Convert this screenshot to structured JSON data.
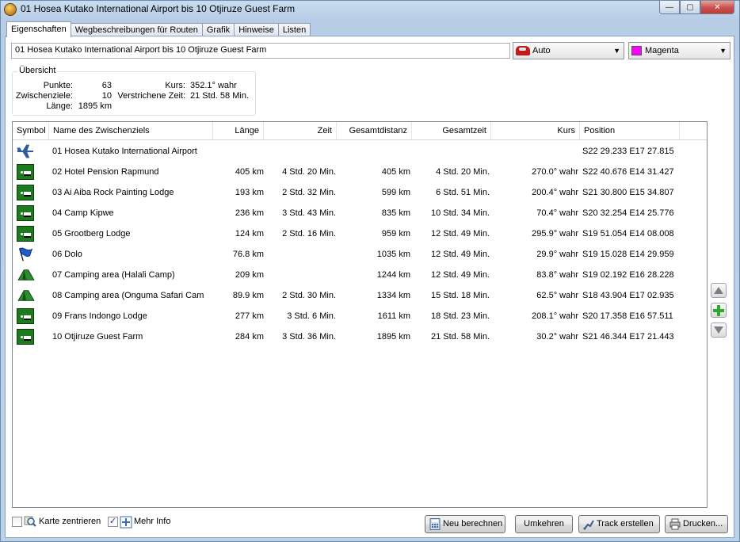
{
  "window": {
    "title": "01 Hosea Kutako International Airport bis 10 Otjiruze Guest Farm",
    "min_symbol": "—",
    "max_symbol": "▢",
    "close_symbol": "✕"
  },
  "tabs": [
    {
      "label": "Eigenschaften",
      "active": true
    },
    {
      "label": "Wegbeschreibungen für Routen",
      "active": false
    },
    {
      "label": "Grafik",
      "active": false
    },
    {
      "label": "Hinweise",
      "active": false
    },
    {
      "label": "Listen",
      "active": false
    }
  ],
  "route_name": "01 Hosea Kutako International Airport bis 10 Otjiruze Guest Farm",
  "transport_mode": {
    "value": "Auto",
    "icon": "car-icon"
  },
  "route_color": {
    "value": "Magenta",
    "swatch": "#ff00ff"
  },
  "overview": {
    "legend": "Übersicht",
    "punkte_label": "Punkte:",
    "punkte_value": "63",
    "zwischenziele_label": "Zwischenziele:",
    "zwischenziele_value": "10",
    "laenge_label": "Länge:",
    "laenge_value": "1895 km",
    "kurs_label": "Kurs:",
    "kurs_value": "352.1° wahr",
    "zeit_label": "Verstrichene Zeit:",
    "zeit_value": "21 Std. 58 Min."
  },
  "table": {
    "headers": {
      "symbol": "Symbol",
      "name": "Name des Zwischenziels",
      "laenge": "Länge",
      "zeit": "Zeit",
      "gesamtdistanz": "Gesamtdistanz",
      "gesamtzeit": "Gesamtzeit",
      "kurs": "Kurs",
      "position": "Position"
    },
    "rows": [
      {
        "icon": "airplane-icon",
        "name": "01 Hosea Kutako International Airport",
        "laenge": "",
        "zeit": "",
        "gesamtdistanz": "",
        "gesamtzeit": "",
        "kurs": "",
        "position": "S22 29.233 E17 27.815"
      },
      {
        "icon": "lodging-icon",
        "name": "02 Hotel Pension Rapmund",
        "laenge": "405 km",
        "zeit": "4 Std. 20 Min.",
        "gesamtdistanz": "405 km",
        "gesamtzeit": "4 Std. 20 Min.",
        "kurs": "270.0° wahr",
        "position": "S22 40.676 E14 31.427"
      },
      {
        "icon": "lodging-icon",
        "name": "03 Ai Aiba Rock Painting Lodge",
        "laenge": "193 km",
        "zeit": "2 Std. 32 Min.",
        "gesamtdistanz": "599 km",
        "gesamtzeit": "6 Std. 51 Min.",
        "kurs": "200.4° wahr",
        "position": "S21 30.800 E15 34.807"
      },
      {
        "icon": "lodging-icon",
        "name": "04 Camp Kipwe",
        "laenge": "236 km",
        "zeit": "3 Std. 43 Min.",
        "gesamtdistanz": "835 km",
        "gesamtzeit": "10 Std. 34 Min.",
        "kurs": "70.4° wahr",
        "position": "S20 32.254 E14 25.776"
      },
      {
        "icon": "lodging-icon",
        "name": "05 Grootberg Lodge",
        "laenge": "124 km",
        "zeit": "2 Std. 16 Min.",
        "gesamtdistanz": "959 km",
        "gesamtzeit": "12 Std. 49 Min.",
        "kurs": "295.9° wahr",
        "position": "S19 51.054 E14 08.008"
      },
      {
        "icon": "flag-icon",
        "name": "06 Dolo",
        "laenge": "76.8 km",
        "zeit": "",
        "gesamtdistanz": "1035 km",
        "gesamtzeit": "12 Std. 49 Min.",
        "kurs": "29.9° wahr",
        "position": "S19 15.028 E14 29.959"
      },
      {
        "icon": "tent-icon",
        "name": "07 Camping area (Halali Camp)",
        "laenge": "209 km",
        "zeit": "",
        "gesamtdistanz": "1244 km",
        "gesamtzeit": "12 Std. 49 Min.",
        "kurs": "83.8° wahr",
        "position": "S19 02.192 E16 28.228"
      },
      {
        "icon": "tent-icon",
        "name": "08 Camping area (Onguma Safari Cam",
        "laenge": "89.9 km",
        "zeit": "2 Std. 30 Min.",
        "gesamtdistanz": "1334 km",
        "gesamtzeit": "15 Std. 18 Min.",
        "kurs": "62.5° wahr",
        "position": "S18 43.904 E17 02.935"
      },
      {
        "icon": "lodging-icon",
        "name": "09 Frans Indongo Lodge",
        "laenge": "277 km",
        "zeit": "3 Std. 6 Min.",
        "gesamtdistanz": "1611 km",
        "gesamtzeit": "18 Std. 23 Min.",
        "kurs": "208.1° wahr",
        "position": "S20 17.358 E16 57.511"
      },
      {
        "icon": "lodging-icon",
        "name": "10 Otjiruze Guest Farm",
        "laenge": "284 km",
        "zeit": "3 Std. 36 Min.",
        "gesamtdistanz": "1895 km",
        "gesamtzeit": "21 Std. 58 Min.",
        "kurs": "30.2° wahr",
        "position": "S21 46.344 E17 21.443"
      }
    ]
  },
  "bottom": {
    "karte_zentrieren": {
      "label": "Karte zentrieren",
      "checked": false
    },
    "mehr_info": {
      "label": "Mehr Info",
      "checked": true,
      "check_mark": "✓"
    },
    "neu_berechnen": "Neu berechnen",
    "umkehren": "Umkehren",
    "track_erstellen": "Track erstellen",
    "drucken": "Drucken..."
  },
  "colors": {
    "lodging_green": "#1f7a1f",
    "flag_blue": "#1e5ec8",
    "tent_green": "#2e8b2e",
    "add_green": "#2ea82e"
  }
}
